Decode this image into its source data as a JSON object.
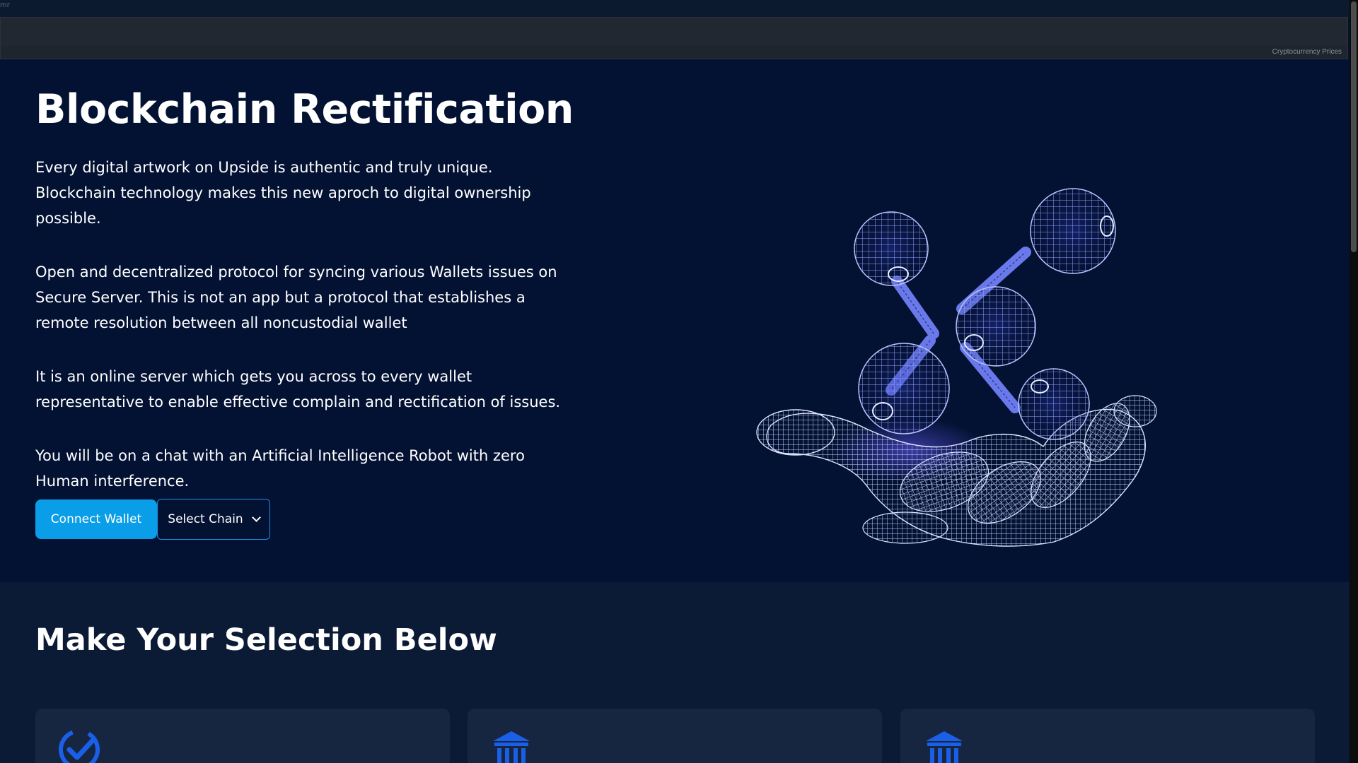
{
  "top_strip": {
    "fragment": "mr"
  },
  "ticker": {
    "credit": "Cryptocurrency Prices"
  },
  "hero": {
    "title": "Blockchain Rectification",
    "paragraphs": [
      "Every digital artwork on Upside is authentic and truly unique. Blockchain technology makes this new aproch to digital ownership possible.",
      "Open and decentralized protocol for syncing various Wallets issues on Secure Server. This is not an app but a protocol that establishes a remote resolution between all noncustodial wallet",
      "It is an online server which gets you across to every wallet representative to enable effective complain and rectification of issues.",
      "You will be on a chat with an Artificial Intelligence Robot with zero Human interference."
    ],
    "connect_label": "Connect Wallet",
    "chain_select_label": "Select Chain",
    "illustration_icon": "wireframe-hand-holding-molecule-icon"
  },
  "selection": {
    "title": "Make Your Selection Below",
    "cards": [
      {
        "icon": "check-circle-icon"
      },
      {
        "icon": "bank-icon"
      },
      {
        "icon": "bank-icon"
      }
    ]
  },
  "colors": {
    "background": "#031233",
    "section_background": "#0b1a35",
    "card_background": "#162640",
    "accent": "#0a9ee8",
    "icon_blue": "#1a5fe8"
  }
}
